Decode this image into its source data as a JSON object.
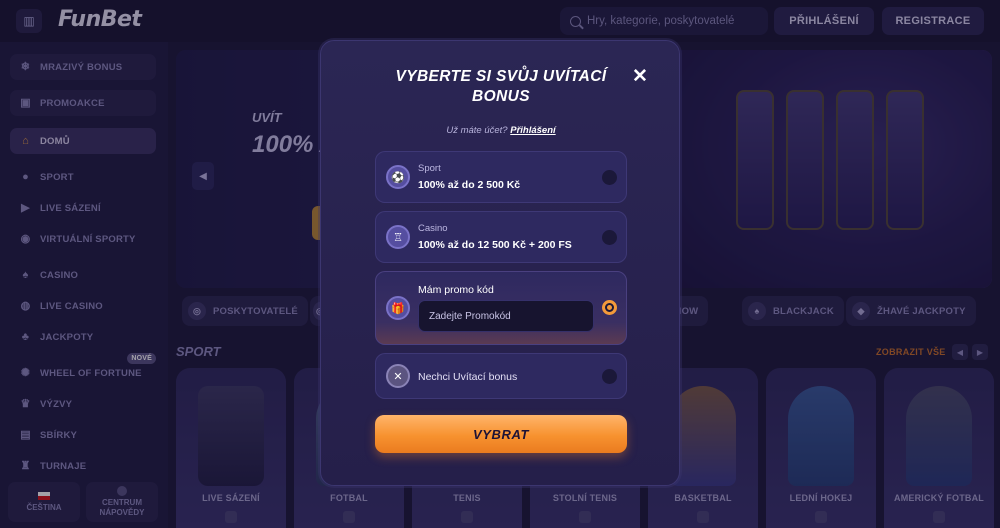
{
  "header": {
    "logo": "FunBet",
    "search_placeholder": "Hry, kategorie, poskytovatelé",
    "login": "PŘIHLÁŠENÍ",
    "register": "REGISTRACE"
  },
  "sidebar": {
    "items": [
      {
        "label": "MRAZIVÝ BONUS",
        "icon": "snowflake-icon"
      },
      {
        "label": "PROMOAKCE",
        "icon": "gift-icon"
      },
      {
        "label": "DOMŮ",
        "icon": "home-icon"
      },
      {
        "label": "SPORT",
        "icon": "ball-icon"
      },
      {
        "label": "LIVE SÁZENÍ",
        "icon": "live-icon"
      },
      {
        "label": "VIRTUÁLNÍ SPORTY",
        "icon": "gamepad-icon"
      },
      {
        "label": "CASINO",
        "icon": "cards-icon"
      },
      {
        "label": "LIVE CASINO",
        "icon": "chips-icon"
      },
      {
        "label": "JACKPOTY",
        "icon": "clover-icon"
      },
      {
        "label": "WHEEL OF FORTUNE",
        "icon": "wheel-icon",
        "badge": "NOVÉ"
      },
      {
        "label": "VÝZVY",
        "icon": "trophy-icon"
      },
      {
        "label": "SBÍRKY",
        "icon": "collection-icon"
      },
      {
        "label": "TURNAJE",
        "icon": "cup-icon"
      }
    ],
    "language": "ČEŠTINA",
    "help_line1": "CENTRUM",
    "help_line2": "NÁPOVĚDY"
  },
  "hero": {
    "line1": "UVÍT",
    "line2": "100% A"
  },
  "chips": [
    {
      "label": "POSKYTOVATELÉ"
    },
    {
      "label": "SHOW"
    },
    {
      "label": "BLACKJACK"
    },
    {
      "label": "ŽHAVÉ JACKPOTY"
    }
  ],
  "sport_section": {
    "title": "SPORT",
    "show_all": "ZOBRAZIT VŠE",
    "cards": [
      "LIVE SÁZENÍ",
      "FOTBAL",
      "TENIS",
      "STOLNÍ TENIS",
      "BASKETBAL",
      "LEDNÍ HOKEJ",
      "AMERICKÝ FOTBAL"
    ]
  },
  "modal": {
    "title": "VYBERTE SI SVŮJ UVÍTACÍ BONUS",
    "login_prompt": "Už máte účet?",
    "login_link": "Přihlášení",
    "options": [
      {
        "small": "Sport",
        "big": "100% až do 2 500 Kč",
        "icon": "soccer-ball-icon",
        "selected": false
      },
      {
        "small": "Casino",
        "big": "100% až do 12 500 Kč + 200 FS",
        "icon": "slot-icon",
        "selected": false
      }
    ],
    "promo": {
      "label": "Mám promo kód",
      "placeholder": "Zadejte Promokód",
      "icon": "gift-icon",
      "selected": true
    },
    "no_bonus": {
      "label": "Nechci Uvítací bonus",
      "icon": "close-circle-icon",
      "selected": false
    },
    "submit": "VYBRAT"
  },
  "colors": {
    "accent": "#f7922f",
    "background": "#1b1838",
    "modal": "#2b2654"
  }
}
